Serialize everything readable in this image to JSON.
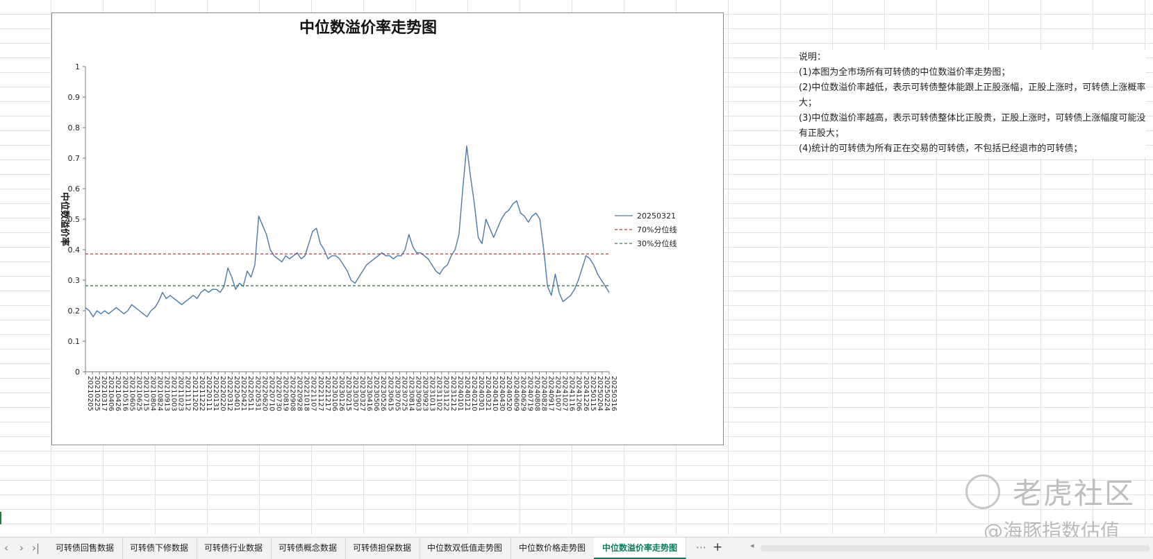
{
  "chart_data": {
    "type": "line",
    "title": "中位数溢价率走势图",
    "ylabel": "中位数溢价率",
    "xlabel": "",
    "ylim": [
      0,
      1
    ],
    "y_ticks": [
      "0",
      "0.1",
      "0.2",
      "0.3",
      "0.4",
      "0.5",
      "0.6",
      "0.7",
      "0.8",
      "0.9",
      "1"
    ],
    "x_tick_labels": [
      "20210205",
      "20210225",
      "20210317",
      "20210406",
      "20210426",
      "20210516",
      "20210605",
      "20210625",
      "20210715",
      "20210804",
      "20210824",
      "20210913",
      "20211003",
      "20211023",
      "20211112",
      "20211202",
      "20211222",
      "20220111",
      "20220131",
      "20220220",
      "20220312",
      "20220401",
      "20220421",
      "20220511",
      "20220531",
      "20220620",
      "20220710",
      "20220730",
      "20220819",
      "20220908",
      "20220928",
      "20221018",
      "20221107",
      "20221127",
      "20221217",
      "20230106",
      "20230126",
      "20230215",
      "20230307",
      "20230327",
      "20230416",
      "20230506",
      "20230526",
      "20230615",
      "20230705",
      "20230725",
      "20230814",
      "20230903",
      "20230923",
      "20231013",
      "20231102",
      "20231122",
      "20231212",
      "20240101",
      "20240121",
      "20240210",
      "20240301",
      "20240321",
      "20240410",
      "20240430",
      "20240520",
      "20240609",
      "20240629",
      "20240719",
      "20240808",
      "20240828",
      "20240917",
      "20241007",
      "20241027",
      "20241116",
      "20241206",
      "20241226",
      "20250115",
      "20250204",
      "20250224",
      "20250316"
    ],
    "legend_position": "right",
    "series": [
      {
        "name": "20250321",
        "color": "#4a78a8",
        "style": "solid",
        "values": [
          0.21,
          0.2,
          0.18,
          0.2,
          0.19,
          0.2,
          0.19,
          0.2,
          0.21,
          0.2,
          0.19,
          0.2,
          0.22,
          0.21,
          0.2,
          0.19,
          0.18,
          0.2,
          0.21,
          0.23,
          0.26,
          0.24,
          0.25,
          0.24,
          0.23,
          0.22,
          0.23,
          0.24,
          0.25,
          0.24,
          0.26,
          0.27,
          0.26,
          0.27,
          0.27,
          0.26,
          0.28,
          0.34,
          0.31,
          0.27,
          0.29,
          0.28,
          0.33,
          0.31,
          0.35,
          0.51,
          0.48,
          0.45,
          0.4,
          0.38,
          0.37,
          0.36,
          0.38,
          0.37,
          0.38,
          0.39,
          0.37,
          0.38,
          0.42,
          0.46,
          0.47,
          0.42,
          0.4,
          0.37,
          0.38,
          0.38,
          0.37,
          0.35,
          0.33,
          0.3,
          0.29,
          0.31,
          0.33,
          0.35,
          0.36,
          0.37,
          0.38,
          0.39,
          0.38,
          0.38,
          0.37,
          0.38,
          0.38,
          0.4,
          0.45,
          0.41,
          0.39,
          0.39,
          0.38,
          0.37,
          0.35,
          0.33,
          0.32,
          0.34,
          0.35,
          0.38,
          0.4,
          0.45,
          0.6,
          0.74,
          0.64,
          0.55,
          0.44,
          0.42,
          0.5,
          0.47,
          0.44,
          0.47,
          0.5,
          0.52,
          0.53,
          0.55,
          0.56,
          0.52,
          0.51,
          0.49,
          0.51,
          0.52,
          0.5,
          0.4,
          0.28,
          0.25,
          0.32,
          0.26,
          0.23,
          0.24,
          0.25,
          0.27,
          0.3,
          0.34,
          0.38,
          0.37,
          0.35,
          0.32,
          0.3,
          0.28,
          0.26
        ]
      },
      {
        "name": "70%分位线",
        "color": "#b03a44",
        "style": "dashed",
        "values": [
          0.386
        ]
      },
      {
        "name": "30%分位线",
        "color": "#3a7a4a",
        "style": "dashed",
        "values": [
          0.282
        ]
      }
    ]
  },
  "notes": {
    "lines": [
      "说明：",
      "(1)本图为全市场所有可转债的中位数溢价率走势图；",
      "(2)中位数溢价率越低，表示可转债整体能跟上正股涨幅，正股上涨时，可转债上涨概率大；",
      "(3)中位数溢价率越高，表示可转债整体比正股贵，正股上涨时，可转债上涨幅度可能没有正股大；",
      "(4)统计的可转债为所有正在交易的可转债，不包括已经退市的可转债；"
    ]
  },
  "tabs": {
    "nav": [
      "‹",
      "›",
      "›|"
    ],
    "items": [
      "可转债回售数据",
      "可转债下修数据",
      "可转债行业数据",
      "可转债概念数据",
      "可转债担保数据",
      "中位数双低值走势图",
      "中位数价格走势图",
      "中位数溢价率走势图"
    ],
    "active_index": 7,
    "more": "⋯",
    "add": "+",
    "scroll_left": "◂"
  },
  "watermark": {
    "title": "老虎社区",
    "subtitle": "@海豚指数估值"
  }
}
